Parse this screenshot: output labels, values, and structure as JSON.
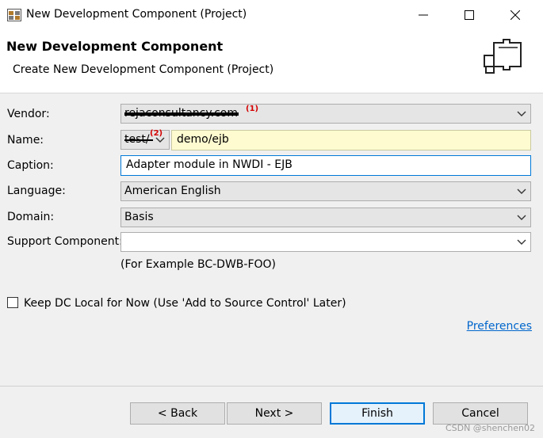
{
  "window": {
    "title": "New Development Component (Project)",
    "minimize_icon": "minimize-icon",
    "maximize_icon": "maximize-icon",
    "close_icon": "close-icon"
  },
  "header": {
    "title": "New Development Component",
    "subtitle": "Create New Development Component (Project)",
    "image": "components-puzzle-icon"
  },
  "form": {
    "vendor": {
      "label": "Vendor:",
      "value": "rejaconsultancy.com",
      "mark": "(1)"
    },
    "name": {
      "label": "Name:",
      "prefix": "test/",
      "value": "demo/ejb",
      "mark": "(2)"
    },
    "caption": {
      "label": "Caption:",
      "value": "Adapter module in NWDI - EJB"
    },
    "language": {
      "label": "Language:",
      "value": "American English"
    },
    "domain": {
      "label": "Domain:",
      "value": "Basis"
    },
    "support_component": {
      "label": "Support Component:",
      "value": "",
      "hint": "(For Example BC-DWB-FOO)"
    },
    "keep_local": {
      "label": "Keep DC Local for Now (Use 'Add to Source Control' Later)",
      "checked": false
    },
    "preferences_link": "Preferences"
  },
  "buttons": {
    "back": "< Back",
    "next": "Next >",
    "finish": "Finish",
    "cancel": "Cancel"
  },
  "watermark": "CSDN @shenchen02",
  "colors": {
    "accent": "#0078d7",
    "link": "#0066cc",
    "redmark": "#d40000",
    "name_highlight": "#fffbd0"
  }
}
